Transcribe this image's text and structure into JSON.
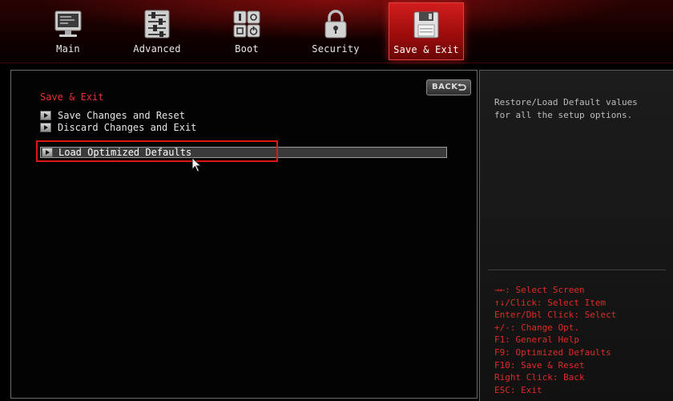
{
  "tabs": [
    {
      "label": "Main",
      "icon": "monitor-icon",
      "active": false
    },
    {
      "label": "Advanced",
      "icon": "sliders-icon",
      "active": false
    },
    {
      "label": "Boot",
      "icon": "boot-devices-icon",
      "active": false
    },
    {
      "label": "Security",
      "icon": "padlock-icon",
      "active": false
    },
    {
      "label": "Save & Exit",
      "icon": "floppy-disk-icon",
      "active": true
    }
  ],
  "main": {
    "section_title": "Save & Exit",
    "back_label": "BACK",
    "items": [
      {
        "label": "Save Changes and Reset"
      },
      {
        "label": "Discard Changes and Exit"
      },
      {
        "label": "Load Optimized Defaults",
        "selected": true
      }
    ]
  },
  "help": {
    "description": "Restore/Load Default values for all the setup options.",
    "keys": [
      "→←: Select Screen",
      "↑↓/Click: Select Item",
      "Enter/Dbl Click: Select",
      "+/-: Change Opt.",
      "F1: General Help",
      "F9: Optimized Defaults",
      "F10: Save & Reset",
      "Right Click: Back",
      "ESC: Exit"
    ]
  },
  "colors": {
    "accent_red": "#e01616",
    "title_red": "#e53333",
    "help_text": "#bdbdbd"
  }
}
